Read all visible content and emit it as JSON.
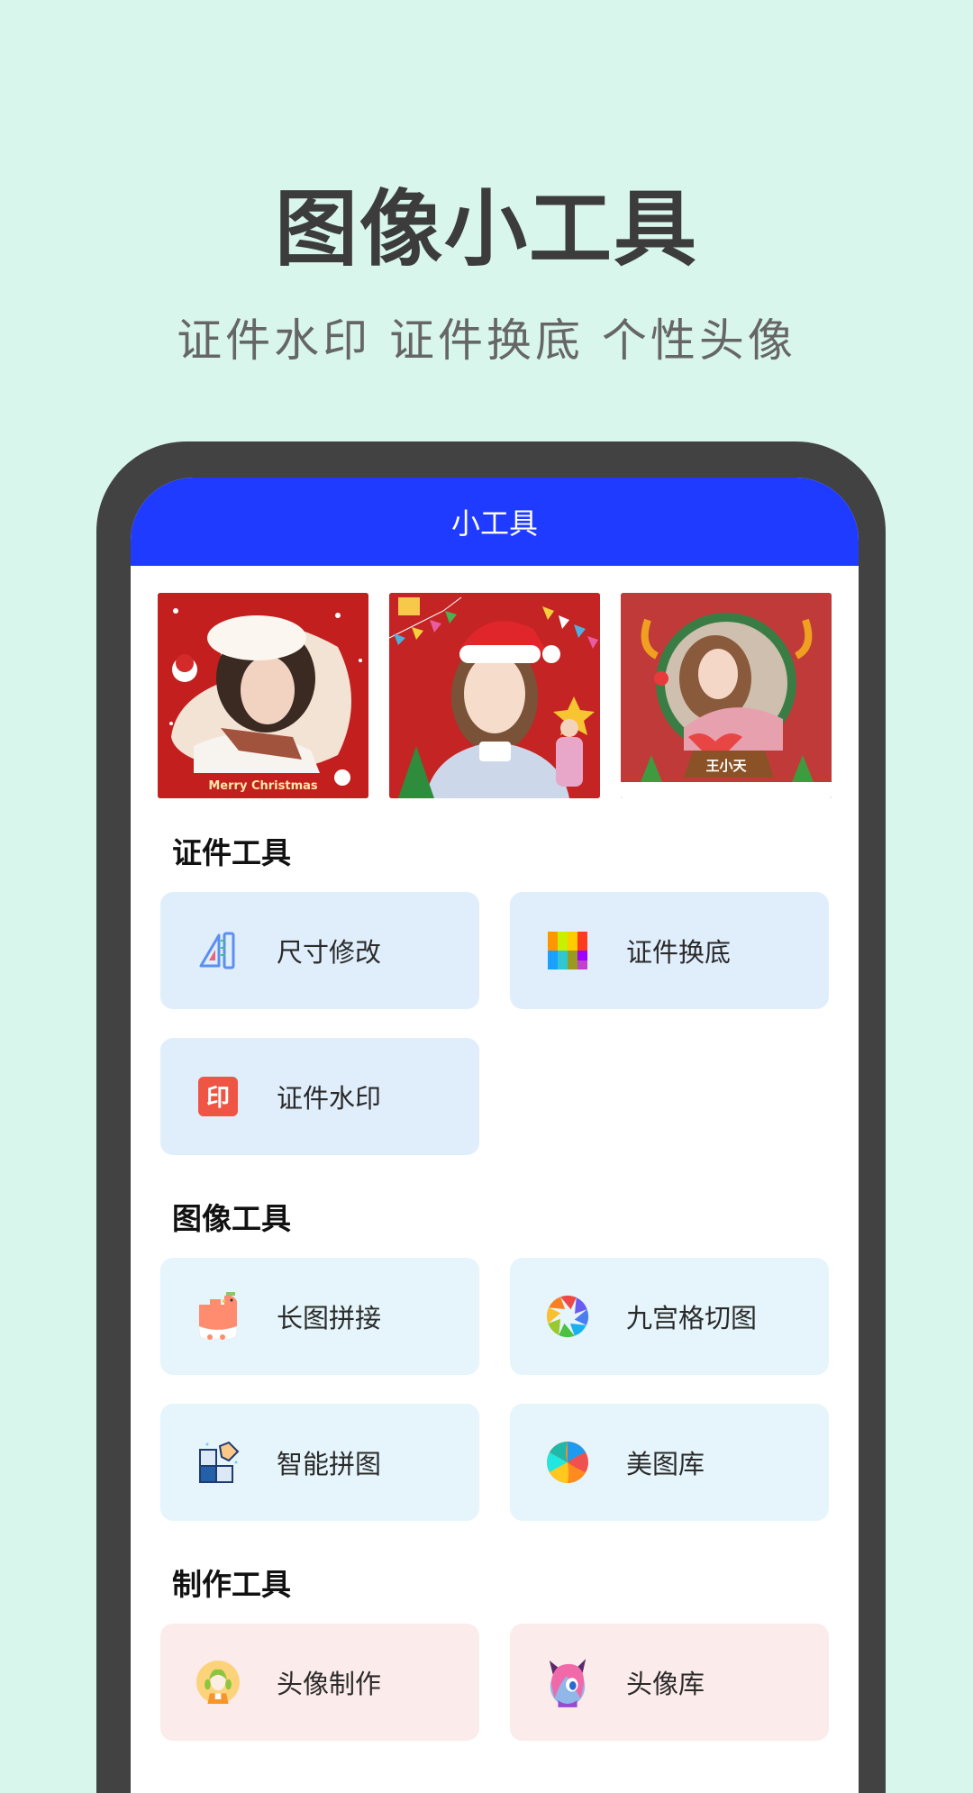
{
  "hero": {
    "title": "图像小工具",
    "subtitle": "证件水印 证件换底 个性头像"
  },
  "app": {
    "title": "小工具",
    "accent_color": "#1f3bff"
  },
  "banners": [
    {
      "name": "merry-christmas-frame",
      "caption": "Merry Christmas"
    },
    {
      "name": "santa-hat-frame",
      "caption": ""
    },
    {
      "name": "wreath-name-frame",
      "caption": "王小天"
    }
  ],
  "sections": [
    {
      "title": "证件工具",
      "items": [
        {
          "label": "尺寸修改",
          "icon": "ruler-triangle-icon"
        },
        {
          "label": "证件换底",
          "icon": "color-palette-icon"
        },
        {
          "label": "证件水印",
          "icon": "stamp-icon",
          "icon_text": "印"
        }
      ]
    },
    {
      "title": "图像工具",
      "items": [
        {
          "label": "长图拼接",
          "icon": "long-image-bird-icon"
        },
        {
          "label": "九宫格切图",
          "icon": "aperture-icon"
        },
        {
          "label": "智能拼图",
          "icon": "puzzle-icon"
        },
        {
          "label": "美图库",
          "icon": "color-swirl-icon"
        }
      ]
    },
    {
      "title": "制作工具",
      "items": [
        {
          "label": "头像制作",
          "icon": "avatar-girl-icon"
        },
        {
          "label": "头像库",
          "icon": "anime-avatar-icon"
        }
      ]
    }
  ]
}
